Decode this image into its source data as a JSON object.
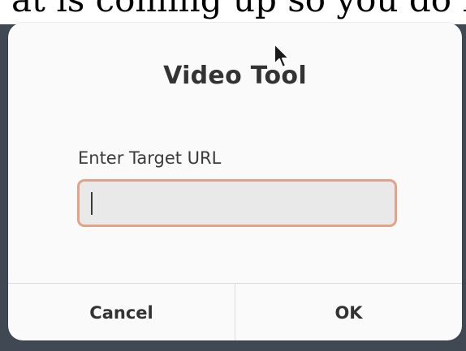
{
  "background_text": "at is coming up so you do not abandon",
  "dialog": {
    "title": "Video Tool",
    "field_label": "Enter Target URL",
    "input": {
      "value": "",
      "placeholder": ""
    },
    "buttons": {
      "cancel": "Cancel",
      "ok": "OK"
    }
  },
  "colors": {
    "input_border": "#e4a088",
    "input_bg": "#e9e9e9",
    "dialog_bg": "#fafafa",
    "backdrop": "#3f4853"
  },
  "icons": {
    "cursor": "mouse-pointer-icon"
  }
}
